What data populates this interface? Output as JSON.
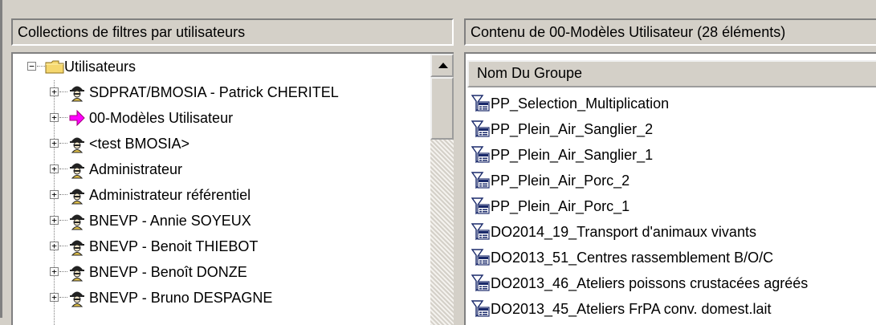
{
  "left_panel": {
    "header": "Collections de filtres par utilisateurs",
    "root": {
      "label": "Utilisateurs",
      "expander": "−",
      "icon": "folder-icon"
    },
    "items": [
      {
        "label": "SDPRAT/BMOSIA - Patrick CHERITEL",
        "icon": "user-icon",
        "expander": "+"
      },
      {
        "label": "00-Modèles Utilisateur",
        "icon": "arrow-right-icon",
        "expander": "+"
      },
      {
        "label": "<test BMOSIA>",
        "icon": "user-icon",
        "expander": "+"
      },
      {
        "label": "Administrateur",
        "icon": "user-icon",
        "expander": "+"
      },
      {
        "label": "Administrateur référentiel",
        "icon": "user-icon",
        "expander": "+"
      },
      {
        "label": "BNEVP - Annie SOYEUX",
        "icon": "user-icon",
        "expander": "+"
      },
      {
        "label": "BNEVP - Benoit THIEBOT",
        "icon": "user-icon",
        "expander": "+"
      },
      {
        "label": "BNEVP - Benoît DONZE",
        "icon": "user-icon",
        "expander": "+"
      },
      {
        "label": "BNEVP - Bruno DESPAGNE",
        "icon": "user-icon",
        "expander": "+"
      }
    ]
  },
  "right_panel": {
    "header": "Contenu de  00-Modèles Utilisateur (28 éléments)",
    "column_header": "Nom Du Groupe",
    "rows": [
      "PP_Selection_Multiplication",
      "PP_Plein_Air_Sanglier_2",
      "PP_Plein_Air_Sanglier_1",
      "PP_Plein_Air_Porc_2",
      "PP_Plein_Air_Porc_1",
      "DO2014_19_Transport d'animaux vivants",
      "DO2013_51_Centres rassemblement B/O/C",
      "DO2013_46_Ateliers poissons crustacées agréés",
      "DO2013_45_Ateliers FrPA conv. domest.lait"
    ]
  },
  "colors": {
    "window_bg": "#d4d0c8",
    "folder": "#f5d76e",
    "arrow": "#ff00ff"
  }
}
